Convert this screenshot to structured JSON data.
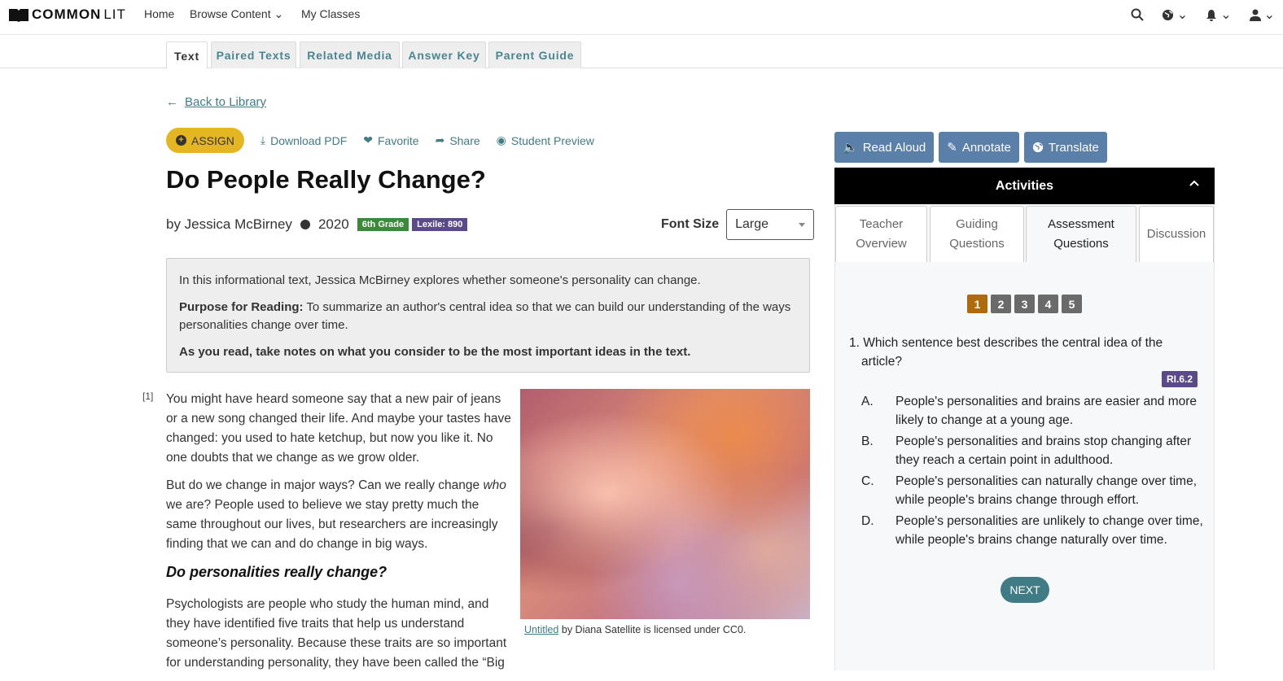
{
  "nav": {
    "logo_bold": "COMMON",
    "logo_light": "LIT",
    "links": [
      "Home",
      "Browse Content",
      "My Classes"
    ]
  },
  "tabs": [
    "Text",
    "Paired Texts",
    "Related Media",
    "Answer Key",
    "Parent Guide"
  ],
  "back_link": "Back to Library",
  "actions": {
    "assign": "ASSIGN",
    "download": "Download PDF",
    "favorite": "Favorite",
    "share": "Share",
    "preview": "Student Preview"
  },
  "title": "Do People Really Change?",
  "meta": {
    "author": "by Jessica McBirney",
    "year": "2020",
    "grade": "6th Grade",
    "lexile": "Lexile: 890",
    "grade_color": "#3a8a3a",
    "lexile_color": "#5b4a8b"
  },
  "font_size": {
    "label": "Font Size",
    "value": "Large"
  },
  "intro": {
    "summary": "In this informational text, Jessica McBirney explores whether someone's personality can change.",
    "purpose_label": "Purpose for Reading:",
    "purpose": " To summarize an author's central idea so that we can build our understanding of the ways personalities change over time.",
    "instruction": "As you read, take notes on what you consider to be the most important ideas in the text."
  },
  "text": {
    "para_number": "[1]",
    "p1": "You might have heard someone say that a new pair of jeans or a new song changed their life. And maybe your tastes have changed: you used to hate ketchup, but now you like it. No one doubts that we change as we grow older.",
    "p2_a": "But do we change in major ways? Can we really change ",
    "p2_em": "who",
    "p2_b": " we are? People used to believe we stay pretty much the same throughout our lives, but researchers are increasingly finding that we can and do change in big ways.",
    "heading": "Do personalities really change?",
    "p3": "Psychologists are people who study the human mind, and they have identified five traits that help us understand someone’s personality. Because these traits are so important for understanding personality, they have been called the “Big"
  },
  "image_caption": {
    "link": "Untitled",
    "rest": " by Diana Satellite is licensed under CC0."
  },
  "tools": [
    "Read Aloud",
    "Annotate",
    "Translate"
  ],
  "activities": {
    "header": "Activities",
    "tabs": [
      {
        "l1": "Teacher",
        "l2": "Overview"
      },
      {
        "l1": "Guiding",
        "l2": "Questions"
      },
      {
        "l1": "Assessment",
        "l2": "Questions"
      },
      {
        "l1": "Discussion",
        "l2": ""
      }
    ],
    "question_numbers": [
      "1",
      "2",
      "3",
      "4",
      "5"
    ],
    "current_question": "1",
    "question": "1. Which sentence best describes the central idea of the article?",
    "standard": "RI.6.2",
    "choices": [
      {
        "letter": "A.",
        "text": "People's personalities and brains are easier and more likely to change at a young age."
      },
      {
        "letter": "B.",
        "text": "People's personalities and brains stop changing after they reach a certain point in adulthood."
      },
      {
        "letter": "C.",
        "text": "People's personalities can naturally change over time, while people's brains change through effort."
      },
      {
        "letter": "D.",
        "text": "People's personalities are unlikely to change over time, while people's brains change naturally over time."
      }
    ],
    "next": "NEXT"
  }
}
